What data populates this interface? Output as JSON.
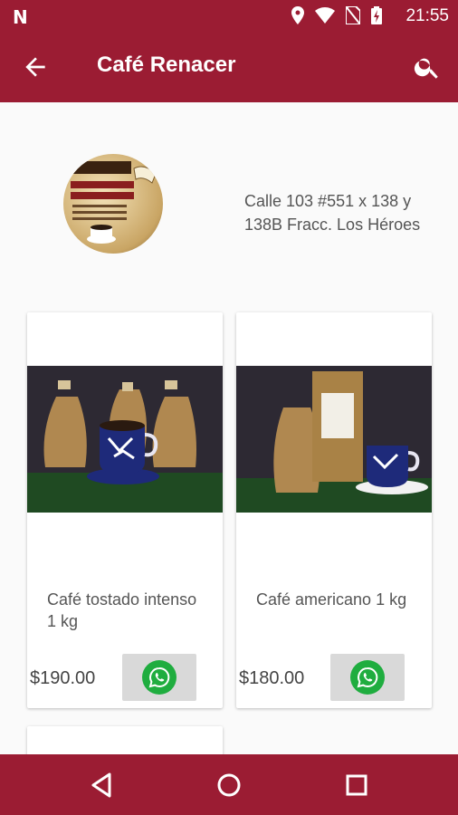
{
  "status_bar": {
    "notification_icon": "N",
    "icons": [
      "location-icon",
      "wifi-icon",
      "no-sim-icon",
      "battery-charging-icon"
    ],
    "time": "21:55"
  },
  "app_bar": {
    "title": "Café Renacer",
    "back_icon": "arrow-back-icon",
    "search_icon": "search-icon"
  },
  "business": {
    "logo_alt": "Café Renacer logo",
    "address": "Calle 103 #551 x 138 y 138B Fracc. Los Héroes"
  },
  "products": [
    {
      "name": "Café tostado intenso 1 kg",
      "price": "$190.00",
      "action_icon": "whatsapp-icon"
    },
    {
      "name": "Café americano 1 kg",
      "price": "$180.00",
      "action_icon": "whatsapp-icon"
    }
  ],
  "nav_bar": {
    "buttons": [
      "back-triangle-icon",
      "home-circle-icon",
      "recents-square-icon"
    ]
  },
  "colors": {
    "primary": "#9b1c33",
    "whatsapp": "#1fad3f",
    "button_bg": "#d9d9d9",
    "background": "#fafafa"
  }
}
